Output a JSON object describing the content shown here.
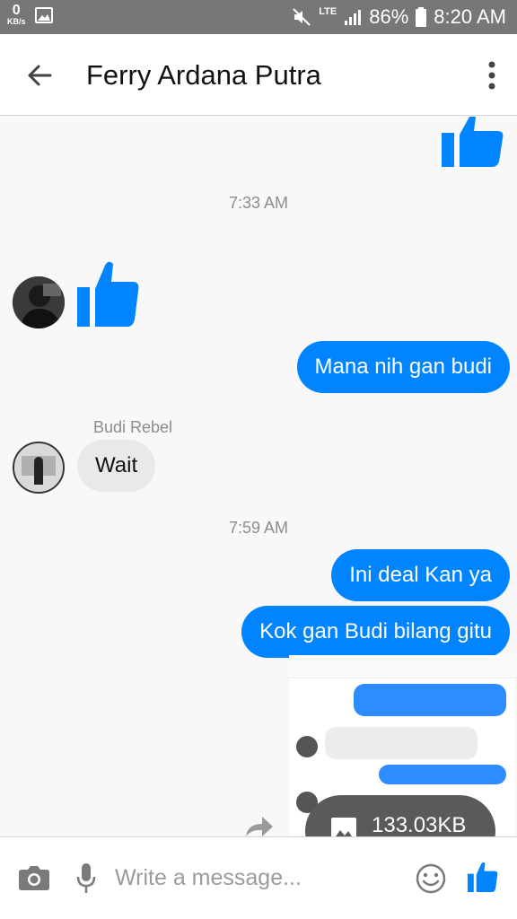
{
  "statusbar": {
    "data_rate_value": "0",
    "data_rate_unit": "KB/s",
    "network": "LTE",
    "battery": "86%",
    "time": "8:20 AM"
  },
  "header": {
    "title": "Ferry Ardana Putra"
  },
  "chat": {
    "timestamp_1": "7:33 AM",
    "timestamp_2": "7:59 AM",
    "messages": [
      {
        "direction": "outgoing",
        "text": "Mana nih gan budi"
      },
      {
        "direction": "incoming",
        "sender": "Budi Rebel",
        "text": "Wait"
      },
      {
        "direction": "outgoing",
        "text": "Ini deal Kan ya"
      },
      {
        "direction": "outgoing",
        "text": "Kok gan Budi bilang gitu"
      }
    ],
    "attachment": {
      "size": "133.03KB"
    }
  },
  "composer": {
    "placeholder": "Write a message..."
  },
  "colors": {
    "accent": "#0084ff",
    "statusbar": "#777777",
    "incoming_bubble": "#e9e9e9"
  },
  "icons": [
    "back-arrow-icon",
    "more-vert-icon",
    "thumbs-up-icon",
    "camera-icon",
    "mic-icon",
    "emoji-icon",
    "image-icon",
    "share-icon",
    "mute-icon",
    "signal-icon",
    "battery-icon",
    "gallery-icon"
  ]
}
